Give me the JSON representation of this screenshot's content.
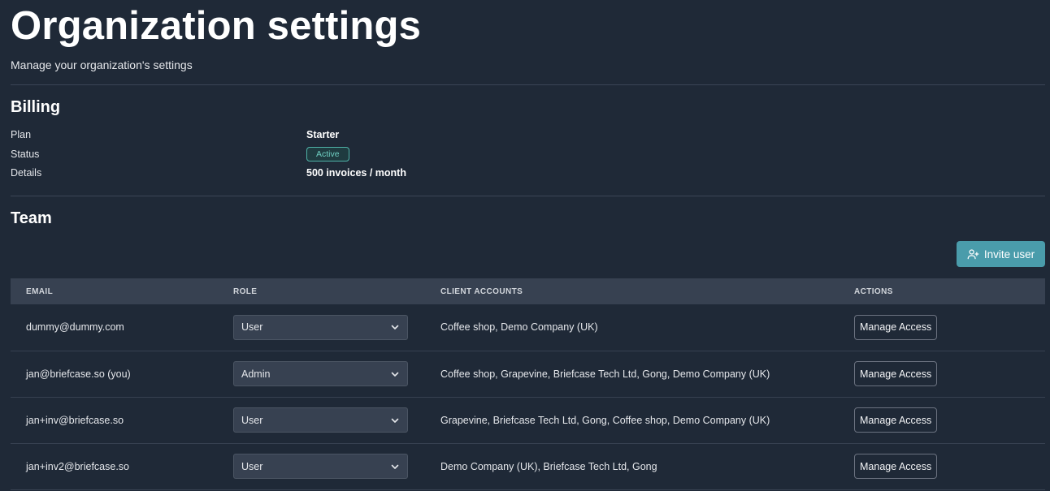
{
  "header": {
    "title": "Organization settings",
    "subtitle": "Manage your organization's settings"
  },
  "billing": {
    "title": "Billing",
    "rows": [
      {
        "label": "Plan",
        "value": "Starter"
      },
      {
        "label": "Status",
        "value": "Active"
      },
      {
        "label": "Details",
        "value": "500 invoices / month"
      }
    ],
    "status_color": "#6fcfc2"
  },
  "team": {
    "title": "Team",
    "invite_label": "Invite user",
    "invite_icon": "user-plus-icon",
    "columns": [
      "EMAIL",
      "ROLE",
      "CLIENT ACCOUNTS",
      "ACTIONS"
    ],
    "members": [
      {
        "email": "dummy@dummy.com",
        "role": "User",
        "clients": "Coffee shop, Demo Company (UK)",
        "action": "Manage Access"
      },
      {
        "email": "jan@briefcase.so (you)",
        "role": "Admin",
        "clients": "Coffee shop, Grapevine, Briefcase Tech Ltd, Gong, Demo Company (UK)",
        "action": "Manage Access"
      },
      {
        "email": "jan+inv@briefcase.so",
        "role": "User",
        "clients": "Grapevine, Briefcase Tech Ltd, Gong, Coffee shop, Demo Company (UK)",
        "action": "Manage Access"
      },
      {
        "email": "jan+inv2@briefcase.so",
        "role": "User",
        "clients": "Demo Company (UK), Briefcase Tech Ltd, Gong",
        "action": "Manage Access"
      }
    ]
  },
  "colors": {
    "background": "#1f2937",
    "accent": "#4a9cab",
    "table_header": "#374151"
  }
}
